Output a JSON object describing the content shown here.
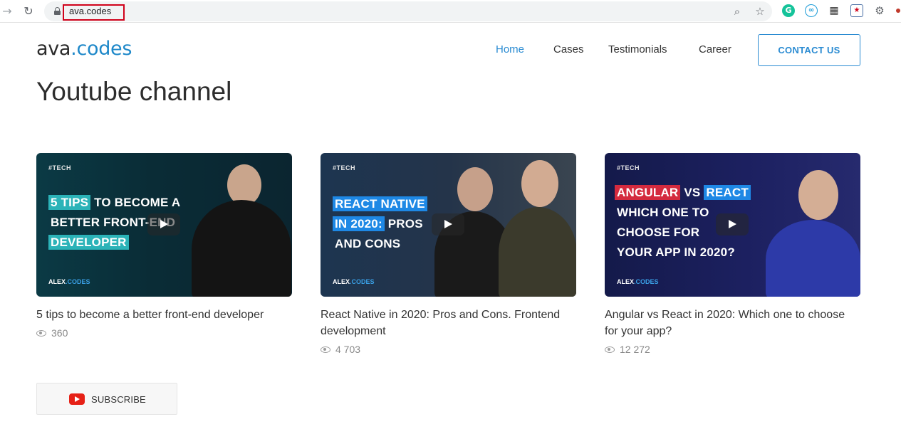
{
  "browser": {
    "url": "ava.codes",
    "back_icon": "back-arrow-icon",
    "reload_icon": "reload-icon",
    "extensions": [
      "grammarly-icon",
      "infinity-icon",
      "grid-icon",
      "extension-box-icon",
      "puzzle-icon"
    ]
  },
  "header": {
    "logo_part1": "ava",
    "logo_part2": ".codes",
    "nav": [
      "Home",
      "Cases",
      "Testimonials",
      "Career"
    ],
    "active_nav": "Home",
    "contact_label": "CONTACT US"
  },
  "main": {
    "title": "Youtube channel",
    "videos": [
      {
        "tag": "#TECH",
        "thumb_lines": [
          "5 TIPS",
          "TO BECOME A",
          "BETTER FRONT-END",
          "DEVELOPER"
        ],
        "brand_a": "ALEX",
        "brand_b": ".CODES",
        "title": "5 tips to become a better front-end developer",
        "views": "360"
      },
      {
        "tag": "#TECH",
        "thumb_lines": [
          "REACT NATIVE",
          "IN 2020:",
          "PROS",
          "AND CONS"
        ],
        "brand_a": "ALEX",
        "brand_b": ".CODES",
        "title": "React Native in 2020: Pros and Cons. Frontend development",
        "views": "4 703"
      },
      {
        "tag": "#TECH",
        "thumb_lines": [
          "ANGULAR",
          "VS",
          "REACT",
          "WHICH ONE TO",
          "CHOOSE FOR",
          "YOUR APP IN 2020?"
        ],
        "brand_a": "ALEX",
        "brand_b": ".CODES",
        "title": "Angular vs React in 2020: Which one to choose for your app?",
        "views": "12 272"
      }
    ],
    "subscribe_label": "SUBSCRIBE"
  },
  "colors": {
    "accent": "#2a8bd2",
    "logo_blue": "#1e88c9",
    "youtube_red": "#e62117"
  }
}
